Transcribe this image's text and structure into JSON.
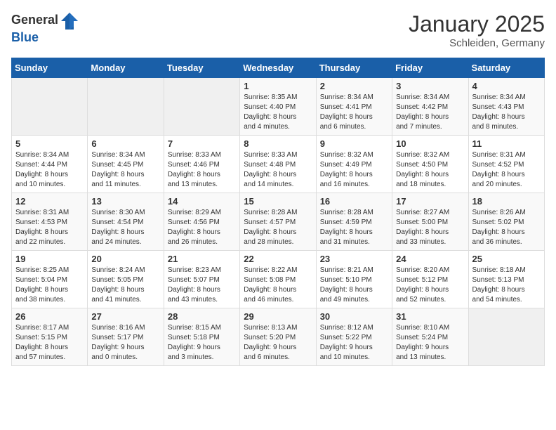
{
  "logo": {
    "general": "General",
    "blue": "Blue"
  },
  "title": "January 2025",
  "location": "Schleiden, Germany",
  "days_header": [
    "Sunday",
    "Monday",
    "Tuesday",
    "Wednesday",
    "Thursday",
    "Friday",
    "Saturday"
  ],
  "weeks": [
    [
      {
        "day": "",
        "info": ""
      },
      {
        "day": "",
        "info": ""
      },
      {
        "day": "",
        "info": ""
      },
      {
        "day": "1",
        "info": "Sunrise: 8:35 AM\nSunset: 4:40 PM\nDaylight: 8 hours\nand 4 minutes."
      },
      {
        "day": "2",
        "info": "Sunrise: 8:34 AM\nSunset: 4:41 PM\nDaylight: 8 hours\nand 6 minutes."
      },
      {
        "day": "3",
        "info": "Sunrise: 8:34 AM\nSunset: 4:42 PM\nDaylight: 8 hours\nand 7 minutes."
      },
      {
        "day": "4",
        "info": "Sunrise: 8:34 AM\nSunset: 4:43 PM\nDaylight: 8 hours\nand 8 minutes."
      }
    ],
    [
      {
        "day": "5",
        "info": "Sunrise: 8:34 AM\nSunset: 4:44 PM\nDaylight: 8 hours\nand 10 minutes."
      },
      {
        "day": "6",
        "info": "Sunrise: 8:34 AM\nSunset: 4:45 PM\nDaylight: 8 hours\nand 11 minutes."
      },
      {
        "day": "7",
        "info": "Sunrise: 8:33 AM\nSunset: 4:46 PM\nDaylight: 8 hours\nand 13 minutes."
      },
      {
        "day": "8",
        "info": "Sunrise: 8:33 AM\nSunset: 4:48 PM\nDaylight: 8 hours\nand 14 minutes."
      },
      {
        "day": "9",
        "info": "Sunrise: 8:32 AM\nSunset: 4:49 PM\nDaylight: 8 hours\nand 16 minutes."
      },
      {
        "day": "10",
        "info": "Sunrise: 8:32 AM\nSunset: 4:50 PM\nDaylight: 8 hours\nand 18 minutes."
      },
      {
        "day": "11",
        "info": "Sunrise: 8:31 AM\nSunset: 4:52 PM\nDaylight: 8 hours\nand 20 minutes."
      }
    ],
    [
      {
        "day": "12",
        "info": "Sunrise: 8:31 AM\nSunset: 4:53 PM\nDaylight: 8 hours\nand 22 minutes."
      },
      {
        "day": "13",
        "info": "Sunrise: 8:30 AM\nSunset: 4:54 PM\nDaylight: 8 hours\nand 24 minutes."
      },
      {
        "day": "14",
        "info": "Sunrise: 8:29 AM\nSunset: 4:56 PM\nDaylight: 8 hours\nand 26 minutes."
      },
      {
        "day": "15",
        "info": "Sunrise: 8:28 AM\nSunset: 4:57 PM\nDaylight: 8 hours\nand 28 minutes."
      },
      {
        "day": "16",
        "info": "Sunrise: 8:28 AM\nSunset: 4:59 PM\nDaylight: 8 hours\nand 31 minutes."
      },
      {
        "day": "17",
        "info": "Sunrise: 8:27 AM\nSunset: 5:00 PM\nDaylight: 8 hours\nand 33 minutes."
      },
      {
        "day": "18",
        "info": "Sunrise: 8:26 AM\nSunset: 5:02 PM\nDaylight: 8 hours\nand 36 minutes."
      }
    ],
    [
      {
        "day": "19",
        "info": "Sunrise: 8:25 AM\nSunset: 5:04 PM\nDaylight: 8 hours\nand 38 minutes."
      },
      {
        "day": "20",
        "info": "Sunrise: 8:24 AM\nSunset: 5:05 PM\nDaylight: 8 hours\nand 41 minutes."
      },
      {
        "day": "21",
        "info": "Sunrise: 8:23 AM\nSunset: 5:07 PM\nDaylight: 8 hours\nand 43 minutes."
      },
      {
        "day": "22",
        "info": "Sunrise: 8:22 AM\nSunset: 5:08 PM\nDaylight: 8 hours\nand 46 minutes."
      },
      {
        "day": "23",
        "info": "Sunrise: 8:21 AM\nSunset: 5:10 PM\nDaylight: 8 hours\nand 49 minutes."
      },
      {
        "day": "24",
        "info": "Sunrise: 8:20 AM\nSunset: 5:12 PM\nDaylight: 8 hours\nand 52 minutes."
      },
      {
        "day": "25",
        "info": "Sunrise: 8:18 AM\nSunset: 5:13 PM\nDaylight: 8 hours\nand 54 minutes."
      }
    ],
    [
      {
        "day": "26",
        "info": "Sunrise: 8:17 AM\nSunset: 5:15 PM\nDaylight: 8 hours\nand 57 minutes."
      },
      {
        "day": "27",
        "info": "Sunrise: 8:16 AM\nSunset: 5:17 PM\nDaylight: 9 hours\nand 0 minutes."
      },
      {
        "day": "28",
        "info": "Sunrise: 8:15 AM\nSunset: 5:18 PM\nDaylight: 9 hours\nand 3 minutes."
      },
      {
        "day": "29",
        "info": "Sunrise: 8:13 AM\nSunset: 5:20 PM\nDaylight: 9 hours\nand 6 minutes."
      },
      {
        "day": "30",
        "info": "Sunrise: 8:12 AM\nSunset: 5:22 PM\nDaylight: 9 hours\nand 10 minutes."
      },
      {
        "day": "31",
        "info": "Sunrise: 8:10 AM\nSunset: 5:24 PM\nDaylight: 9 hours\nand 13 minutes."
      },
      {
        "day": "",
        "info": ""
      }
    ]
  ]
}
